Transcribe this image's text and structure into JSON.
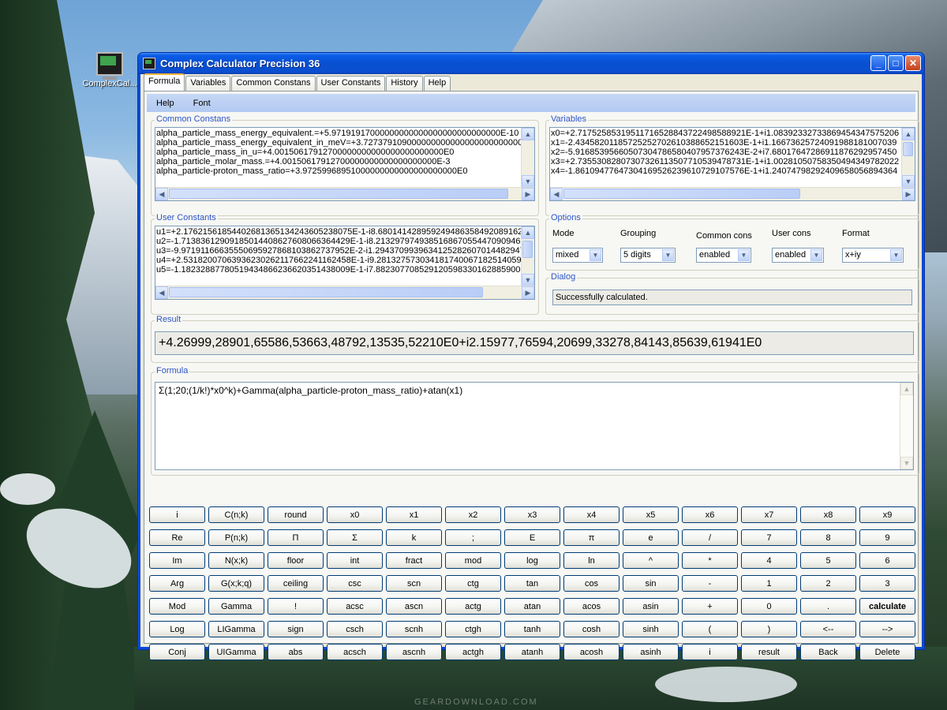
{
  "desktop": {
    "icon_label": "ComplexCal...",
    "watermark": "GEARDOWNLOAD.COM"
  },
  "window": {
    "title": "Complex Calculator Precision 36",
    "minimize_glyph": "_",
    "maximize_glyph": "□",
    "close_glyph": "✕"
  },
  "tabs": [
    "Formula",
    "Variables",
    "Common Constans",
    "User Constants",
    "History",
    "Help"
  ],
  "menu": [
    "Help",
    "Font"
  ],
  "common_constants": {
    "label": "Common Constans",
    "lines": [
      "alpha_particle_mass_energy_equivalent.=+5.97191917000000000000000000000000000E-10",
      "alpha_particle_mass_energy_equivalent_in_meV=+3.72737910900000000000000000000000000E",
      "alpha_particle_mass_in_u=+4.00150617912700000000000000000000000E0",
      "alpha_particle_molar_mass.=+4.00150617912700000000000000000000E-3",
      "alpha_particle-proton_mass_ratio=+3.97259968951000000000000000000000E0"
    ]
  },
  "variables": {
    "label": "Variables",
    "lines": [
      "x0=+2.71752585319511716528843722498588921E-1+i1.08392332733869454347575206",
      "x1=-2.43458201185725252702610388652151603E-1+i1.16673625724091988181007039",
      "x2=-5.91685395660507304786580407957376243E-2+i7.68017647286911876292957450",
      "x3=+2.73553082807307326113507710539478731E-1+i1.00281050758350494349782022",
      "x4=-1.86109477647304169526239610729107576E-1+i1.24074798292409658056894364"
    ]
  },
  "user_constants": {
    "label": "User Constants",
    "lines": [
      "u1=+2.17621561854402681365134243605238075E-1-i8.68014142895924948635849208916273",
      "u2=-1.71383612909185014408627608066364429E-1-i8.21329797493851686705544709094635",
      "u3=-9.97191166635550695927868103862737952E-2-i1.29437099396341252826070144829478",
      "u4=+2.53182007063936230262117662241162458E-1-i9.28132757303418174006718251405937",
      "u5=-1.18232887780519434866236620351438009E-1-i7.88230770852912059833016288590002"
    ]
  },
  "options": {
    "label": "Options",
    "mode": {
      "label": "Mode",
      "value": "mixed"
    },
    "grouping": {
      "label": "Grouping",
      "value": "5 digits"
    },
    "common_cons": {
      "label": "Common cons",
      "value": "enabled"
    },
    "user_cons": {
      "label": "User cons",
      "value": "enabled"
    },
    "format": {
      "label": "Format",
      "value": "x+iy"
    }
  },
  "dialog": {
    "label": "Dialog",
    "message": "Successfully calculated."
  },
  "result": {
    "label": "Result",
    "value": "+4.26999,28901,65586,53663,48792,13535,52210E0+i2.15977,76594,20699,33278,84143,85639,61941E0"
  },
  "formula": {
    "label": "Formula",
    "value": "Σ(1;20;(1/k!)*x0^k)+Gamma(alpha_particle-proton_mass_ratio)+atan(x1)"
  },
  "keypad": [
    [
      "i",
      "C(n;k)",
      "round",
      "x0",
      "x1",
      "x2",
      "x3",
      "x4",
      "x5",
      "x6",
      "x7",
      "x8",
      "x9"
    ],
    [
      "Re",
      "P(n;k)",
      "Π",
      "Σ",
      "k",
      ";",
      "E",
      "π",
      "e",
      "/",
      "7",
      "8",
      "9"
    ],
    [
      "Im",
      "N(x;k)",
      "floor",
      "int",
      "fract",
      "mod",
      "log",
      "ln",
      "^",
      "*",
      "4",
      "5",
      "6"
    ],
    [
      "Arg",
      "G(x;k;q)",
      "ceiling",
      "csc",
      "scn",
      "ctg",
      "tan",
      "cos",
      "sin",
      "-",
      "1",
      "2",
      "3"
    ],
    [
      "Mod",
      "Gamma",
      "!",
      "acsc",
      "ascn",
      "actg",
      "atan",
      "acos",
      "asin",
      "+",
      "0",
      ".",
      "calculate"
    ],
    [
      "Log",
      "LIGamma",
      "sign",
      "csch",
      "scnh",
      "ctgh",
      "tanh",
      "cosh",
      "sinh",
      "(",
      ")",
      "<--",
      "-->"
    ],
    [
      "Conj",
      "UIGamma",
      "abs",
      "acsch",
      "ascnh",
      "actgh",
      "atanh",
      "acosh",
      "asinh",
      "i",
      "result",
      "Back",
      "Delete"
    ]
  ]
}
